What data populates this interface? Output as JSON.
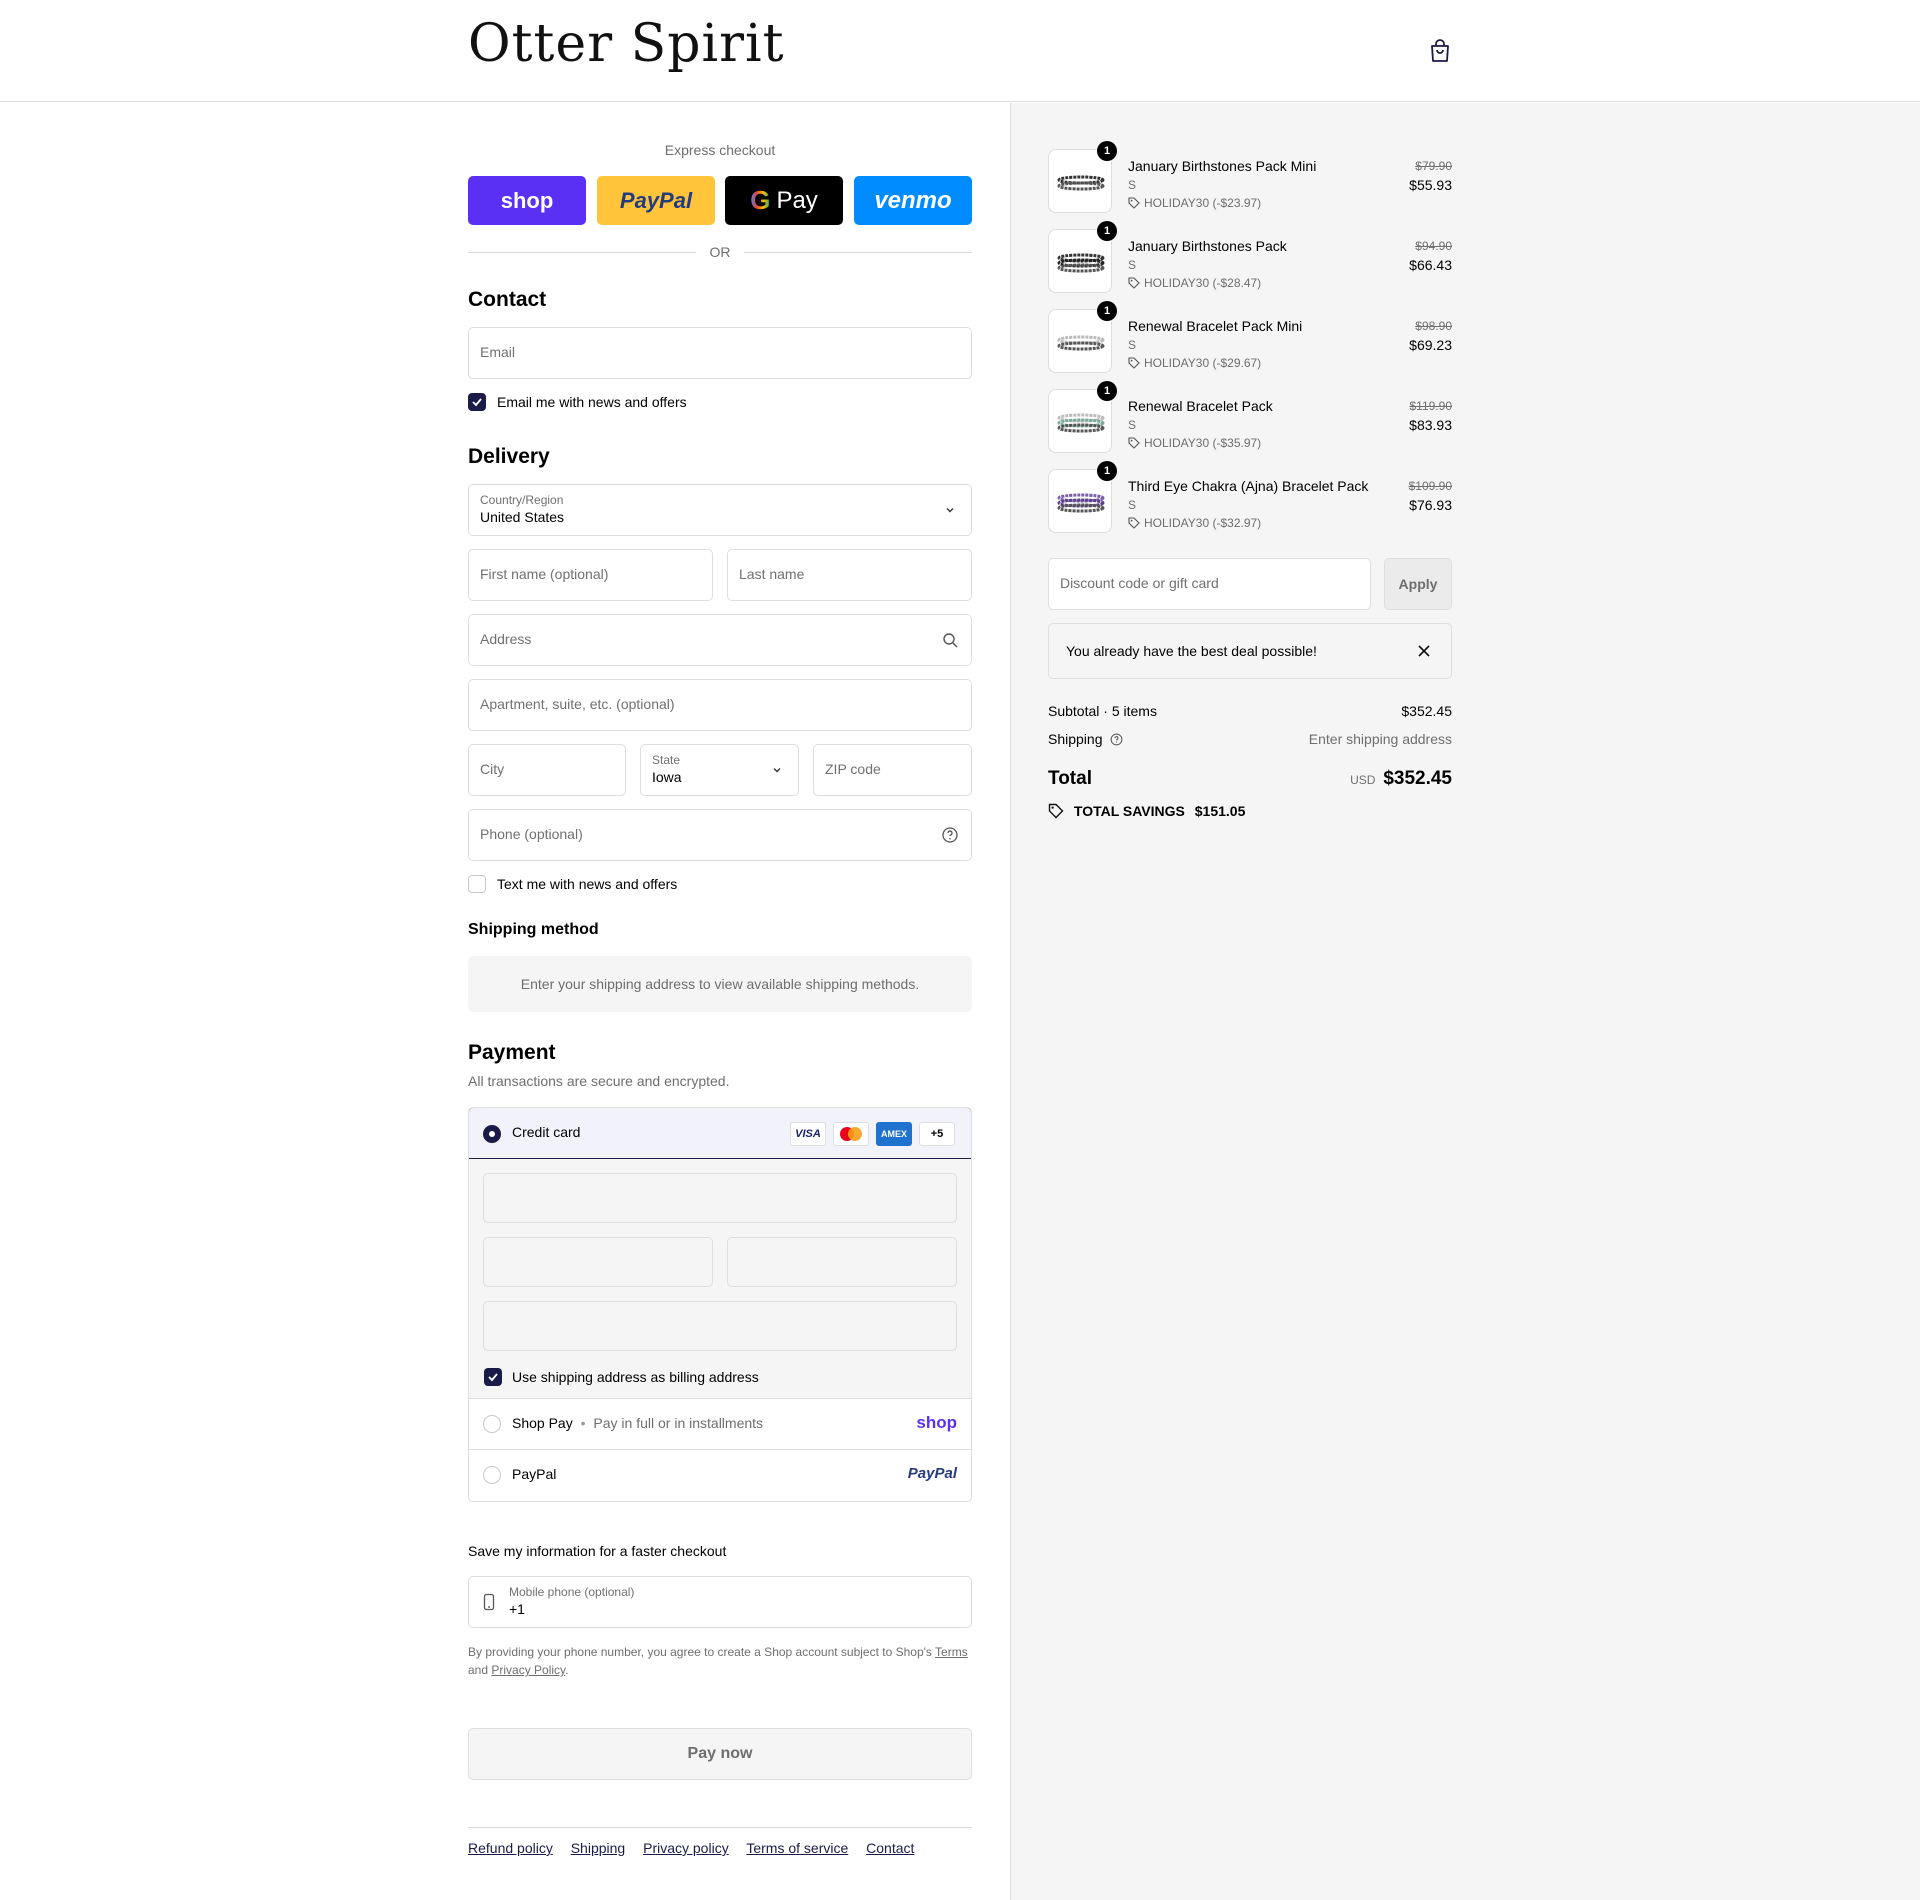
{
  "header": {
    "brand": "Otter Spirit",
    "bag_icon": "shopping-bag-icon"
  },
  "express": {
    "title": "Express checkout",
    "shop": "shop",
    "paypal": "PayPal",
    "gpay": "Pay",
    "venmo": "venmo",
    "or": "OR"
  },
  "contact": {
    "title": "Contact",
    "email_placeholder": "Email",
    "news_label": "Email me with news and offers",
    "news_checked": true
  },
  "delivery": {
    "title": "Delivery",
    "country_label": "Country/Region",
    "country_value": "United States",
    "first_name": "First name (optional)",
    "last_name": "Last name",
    "address": "Address",
    "apartment": "Apartment, suite, etc. (optional)",
    "city": "City",
    "state_label": "State",
    "state_value": "Iowa",
    "zip": "ZIP code",
    "phone": "Phone (optional)",
    "text_label": "Text me with news and offers",
    "text_checked": false
  },
  "shipping_method": {
    "title": "Shipping method",
    "message": "Enter your shipping address to view available shipping methods."
  },
  "payment": {
    "title": "Payment",
    "subtitle": "All transactions are secure and encrypted.",
    "credit_card": "Credit card",
    "cards": {
      "visa": "VISA",
      "amex": "AMEX",
      "more": "+5"
    },
    "billing_label": "Use shipping address as billing address",
    "shop_pay": "Shop Pay",
    "shop_pay_sub": "Pay in full or in installments",
    "shop_pay_logo": "shop",
    "paypal": "PayPal",
    "paypal_logo": "PayPal"
  },
  "save_info": {
    "title": "Save my information for a faster checkout",
    "mobile_label": "Mobile phone (optional)",
    "mobile_value": "+1",
    "terms_pre": "By providing your phone number, you agree to create a Shop account subject to Shop's",
    "terms_link": "Terms",
    "terms_and": "and",
    "privacy_link": "Privacy Policy",
    "terms_end": "."
  },
  "pay_now": "Pay now",
  "footer": [
    "Refund policy",
    "Shipping",
    "Privacy policy",
    "Terms of service",
    "Contact"
  ],
  "order": {
    "items": [
      {
        "qty": "1",
        "name": "January Birthstones Pack Mini",
        "variant": "S",
        "discount": "HOLIDAY30 (-$23.97)",
        "old_price": "$79.90",
        "price": "$55.93"
      },
      {
        "qty": "1",
        "name": "January Birthstones Pack",
        "variant": "S",
        "discount": "HOLIDAY30 (-$28.47)",
        "old_price": "$94.90",
        "price": "$66.43"
      },
      {
        "qty": "1",
        "name": "Renewal Bracelet Pack Mini",
        "variant": "S",
        "discount": "HOLIDAY30 (-$29.67)",
        "old_price": "$98.90",
        "price": "$69.23"
      },
      {
        "qty": "1",
        "name": "Renewal Bracelet Pack",
        "variant": "S",
        "discount": "HOLIDAY30 (-$35.97)",
        "old_price": "$119.90",
        "price": "$83.93"
      },
      {
        "qty": "1",
        "name": "Third Eye Chakra (Ajna) Bracelet Pack",
        "variant": "S",
        "discount": "HOLIDAY30 (-$32.97)",
        "old_price": "$109.90",
        "price": "$76.93"
      }
    ],
    "discount_placeholder": "Discount code or gift card",
    "apply": "Apply",
    "notice": "You already have the best deal possible!",
    "subtotal_label": "Subtotal · 5 items",
    "subtotal_value": "$352.45",
    "shipping_label": "Shipping",
    "shipping_value": "Enter shipping address",
    "total_label": "Total",
    "currency": "USD",
    "total_value": "$352.45",
    "savings_label": "TOTAL SAVINGS",
    "savings_value": "$151.05"
  },
  "colors": {
    "accent": "#1b1b4a",
    "shop": "#5a31f4",
    "paypal": "#ffc439",
    "venmo": "#008cff"
  }
}
